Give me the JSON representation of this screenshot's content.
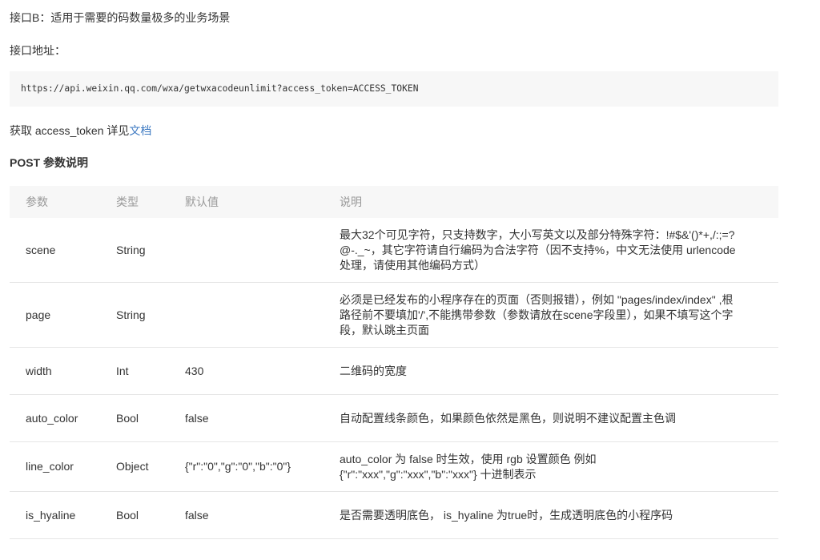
{
  "page": {
    "title": "接口B：适用于需要的码数量极多的业务场景",
    "address_label": "接口地址：",
    "endpoint_url": "https://api.weixin.qq.com/wxa/getwxacodeunlimit?access_token=ACCESS_TOKEN",
    "token_note": "获取 access_token 详见",
    "token_doc_link": "文档"
  },
  "params": {
    "heading": "POST 参数说明",
    "columns": {
      "name": "参数",
      "type": "类型",
      "default": "默认值",
      "description": "说明"
    },
    "rows": [
      {
        "name": "scene",
        "type": "String",
        "default": "",
        "description": [
          "最大32个可见字符，只支持数字，大小写英文以及部分特殊字符：!#$&'()*+,/:;=?",
          "@-._~，其它字符请自行编码为合法字符（因不支持%，中文无法使用 urlencode",
          "处理，请使用其他编码方式）"
        ]
      },
      {
        "name": "page",
        "type": "String",
        "default": "",
        "description": [
          "必须是已经发布的小程序存在的页面（否则报错），例如 \"pages/index/index\" ,根",
          "路径前不要填加'/',不能携带参数（参数请放在scene字段里），如果不填写这个字",
          "段，默认跳主页面"
        ]
      },
      {
        "name": "width",
        "type": "Int",
        "default": "430",
        "description": [
          "二维码的宽度"
        ]
      },
      {
        "name": "auto_color",
        "type": "Bool",
        "default": "false",
        "description": [
          "自动配置线条颜色，如果颜色依然是黑色，则说明不建议配置主色调"
        ]
      },
      {
        "name": "line_color",
        "type": "Object",
        "default": "{\"r\":\"0\",\"g\":\"0\",\"b\":\"0\"}",
        "description": [
          "auto_color 为 false 时生效，使用 rgb 设置颜色 例如",
          "{\"r\":\"xxx\",\"g\":\"xxx\",\"b\":\"xxx\"} 十进制表示"
        ]
      },
      {
        "name": "is_hyaline",
        "type": "Bool",
        "default": "false",
        "description": [
          "是否需要透明底色， is_hyaline 为true时，生成透明底色的小程序码"
        ]
      }
    ]
  },
  "colors": {
    "text": "#333333",
    "muted": "#999999",
    "link": "#3b78c1",
    "block": "#f7f7f7",
    "divider": "#e5e5e5"
  }
}
